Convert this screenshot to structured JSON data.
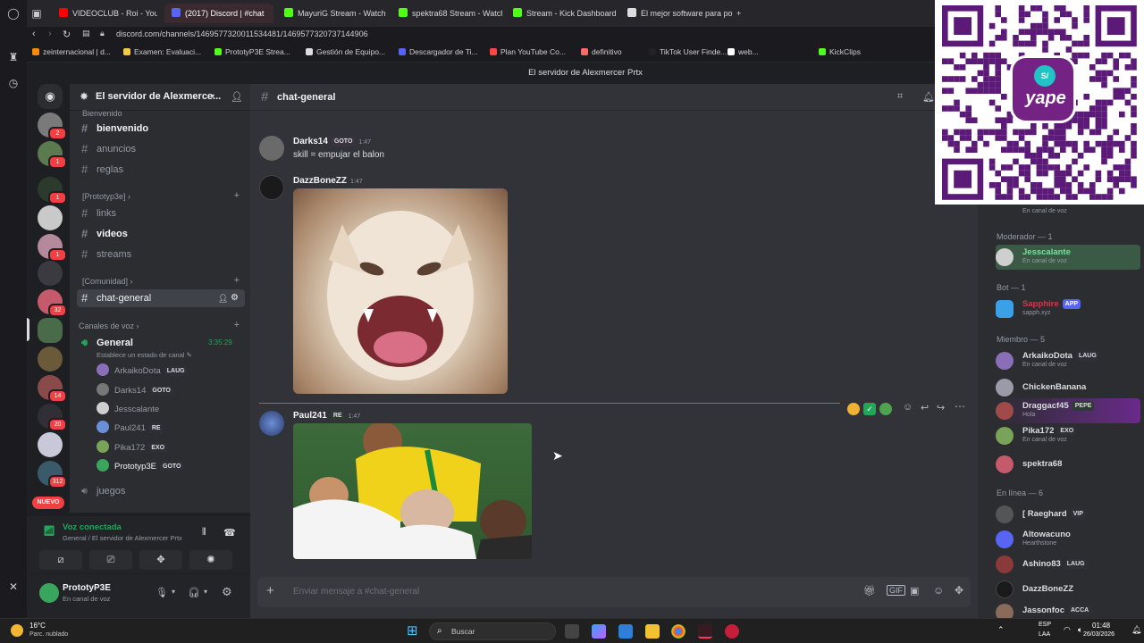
{
  "browser": {
    "tabs": [
      {
        "label": "VIDEOCLUB - Roi - YouTu",
        "color": "#ff0000"
      },
      {
        "label": "(2017) Discord | #chat",
        "color": "#5865f2",
        "active": true
      },
      {
        "label": "MayuriG Stream - Watch L",
        "color": "#53fc18"
      },
      {
        "label": "spektra68 Stream - Watch",
        "color": "#53fc18"
      },
      {
        "label": "Stream - Kick Dashboard",
        "color": "#53fc18"
      },
      {
        "label": "El mejor software para po",
        "color": "#dddddd"
      }
    ],
    "url": "discord.com/channels/1469577320011534481/1469577320737144906",
    "bookmarks": [
      {
        "label": "zeinternacional | d...",
        "color": "#f48c06"
      },
      {
        "label": "Examen: Evaluaci...",
        "color": "#f2c94c"
      },
      {
        "label": "PrototyP3E Strea...",
        "color": "#53fc18"
      },
      {
        "label": "Gestión de Equipo...",
        "color": "#dddddd"
      },
      {
        "label": "Descargador de Ti...",
        "color": "#5865f2"
      },
      {
        "label": "Plan YouTube Co...",
        "color": "#ff0000"
      },
      {
        "label": "definitivo",
        "color": "#ff6b6b"
      },
      {
        "label": "TikTok User Finde...",
        "color": "#222222"
      },
      {
        "label": "web...",
        "color": "#ffffff"
      },
      {
        "label": "KickClips",
        "color": "#53fc18"
      }
    ]
  },
  "discord": {
    "window_title": "El servidor de Alexmercer Prtx",
    "server_name": "El servidor de Alexmerce...",
    "rail_badges": [
      "2",
      "1",
      "1",
      "1",
      "32",
      "14",
      "20",
      "312"
    ],
    "new_label": "NUEVO",
    "categories": {
      "bienvenido_partial": "Bienvenido",
      "prototyp": "Prototyp3e",
      "comunidad": "Comunidad",
      "voice": "Canales de voz"
    },
    "channels": [
      {
        "name": "bienvenido",
        "unread": true
      },
      {
        "name": "anuncios",
        "unread": false
      },
      {
        "name": "reglas",
        "unread": false
      },
      {
        "name": "links",
        "unread": false
      },
      {
        "name": "videos",
        "unread": true
      },
      {
        "name": "streams",
        "unread": false
      },
      {
        "name": "chat-general",
        "selected": true
      }
    ],
    "voice_channel": {
      "name": "General",
      "timer": "3:35:29",
      "status_hint": "Establece un estado de canal",
      "users": [
        {
          "name": "ArkaikoDota",
          "tag": "LAUG",
          "color": "#8a6fb8"
        },
        {
          "name": "Darks14",
          "tag": "GOTO",
          "color": "#777777"
        },
        {
          "name": "Jesscalante",
          "tag": "",
          "color": "#cfcfcf"
        },
        {
          "name": "Paul241",
          "tag": "RE",
          "color": "#6b8fd6"
        },
        {
          "name": "Pika172",
          "tag": "EXO",
          "color": "#7aa35a"
        },
        {
          "name": "Prototyp3E",
          "tag": "GOTO",
          "color": "#3aa55d"
        }
      ]
    },
    "juegos_channel": "juegos",
    "voice_connected": {
      "title": "Voz conectada",
      "subtitle": "General / El servidor de Alexmercer Prtx"
    },
    "user": {
      "name": "PrototyP3E",
      "status": "En canal de voz"
    },
    "chat": {
      "channel": "chat-general",
      "messages": [
        {
          "author": "Darks14",
          "tag": "GOTO",
          "time": "1:47",
          "text": "skill = empujar el balon"
        },
        {
          "author": "DazzBoneZZ",
          "tag": "",
          "time": "1:47",
          "text": ""
        },
        {
          "author": "Paul241",
          "tag": "RE",
          "time": "1:47",
          "text": ""
        }
      ],
      "composer_placeholder": "Enviar mensaje a #chat-general"
    },
    "members": {
      "partial_top": "En canal de voz",
      "groups": [
        {
          "role": "Moderador — 1",
          "items": [
            {
              "name": "Jesscalante",
              "sub": "En canal de voz",
              "color": "#7fdc9b"
            }
          ]
        },
        {
          "role": "Bot — 1",
          "items": [
            {
              "name": "Sapphire",
              "sub": "sapph.xyz",
              "badge": "APP",
              "color": "#d13a4a"
            }
          ]
        },
        {
          "role": "Miembro — 5",
          "items": [
            {
              "name": "ArkaikoDota",
              "sub": "En canal de voz",
              "badge": "LAUG",
              "color": "#dbdee1"
            },
            {
              "name": "ChickenBanana",
              "sub": "",
              "color": "#dbdee1"
            },
            {
              "name": "Draggacf45",
              "sub": "Hola",
              "badge": "PEPE",
              "color": "#dbdee1"
            },
            {
              "name": "Pika172",
              "sub": "En canal de voz",
              "badge": "EXO",
              "color": "#dbdee1"
            },
            {
              "name": "spektra68",
              "sub": "",
              "color": "#dbdee1"
            }
          ]
        },
        {
          "role": "En línea — 6",
          "items": [
            {
              "name": "[ Raeghard",
              "sub": "",
              "badge": "VIP",
              "color": "#dbdee1"
            },
            {
              "name": "Altowacuno",
              "sub": "Hearthstone",
              "color": "#dbdee1"
            },
            {
              "name": "Ashino83",
              "sub": "",
              "badge": "LAUG",
              "color": "#dbdee1"
            },
            {
              "name": "DazzBoneZZ",
              "sub": "",
              "color": "#dbdee1"
            },
            {
              "name": "Jassonfoc",
              "sub": "",
              "badge": "ACCA",
              "color": "#dbdee1"
            }
          ]
        }
      ]
    }
  },
  "overlay": {
    "qr_brand": "yape",
    "qr_mark": "S/"
  },
  "taskbar": {
    "weather_temp": "16°C",
    "weather_text": "Parc. nublado",
    "search_placeholder": "Buscar",
    "lang": "ESP",
    "region": "LAA",
    "time": "01:48",
    "date": "26/03/2026"
  }
}
